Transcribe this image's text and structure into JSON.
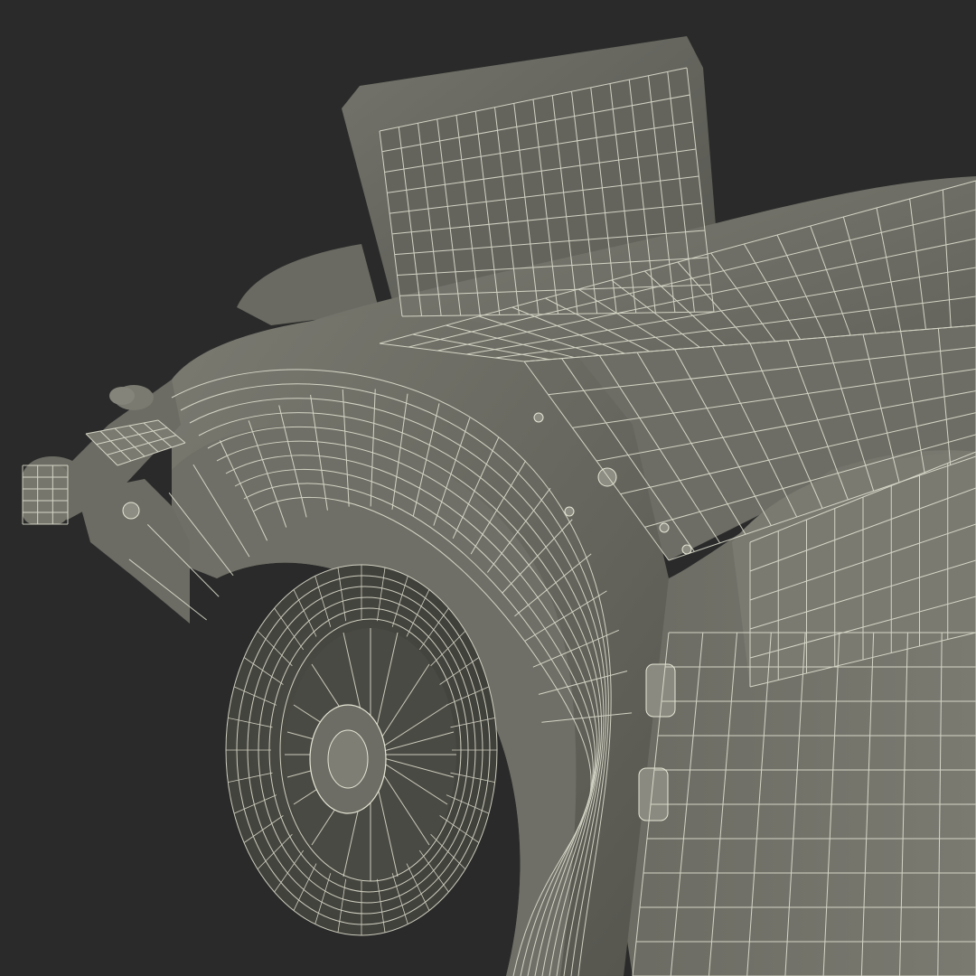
{
  "colors": {
    "background": "#2a2a2a",
    "surface": "#6e6e66",
    "surface_light": "#8a8a80",
    "surface_dark": "#4e4e48",
    "wire": "#e6e6d6"
  },
  "subject": "wireframe-3d-render-of-vintage-car-rear"
}
